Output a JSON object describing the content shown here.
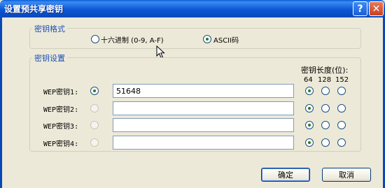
{
  "window": {
    "title": "设置预共享密钥",
    "help_glyph": "?",
    "close_glyph": "✕"
  },
  "format_group": {
    "legend": "密钥格式",
    "hex_label": "十六进制 (0-9, A-F)",
    "ascii_label": "ASCII码",
    "selected": "ascii"
  },
  "keys_group": {
    "legend": "密钥设置",
    "length_header": "密钥长度(位):",
    "length_options": [
      "64",
      "128",
      "152"
    ],
    "rows": [
      {
        "label": "WEP密钥1:",
        "value": "51648",
        "active": true,
        "length": "64"
      },
      {
        "label": "WEP密钥2:",
        "value": "",
        "active": false,
        "length": "64"
      },
      {
        "label": "WEP密钥3:",
        "value": "",
        "active": false,
        "length": "64"
      },
      {
        "label": "WEP密钥4:",
        "value": "",
        "active": false,
        "length": "64"
      }
    ]
  },
  "buttons": {
    "ok": "确定",
    "cancel": "取消"
  }
}
